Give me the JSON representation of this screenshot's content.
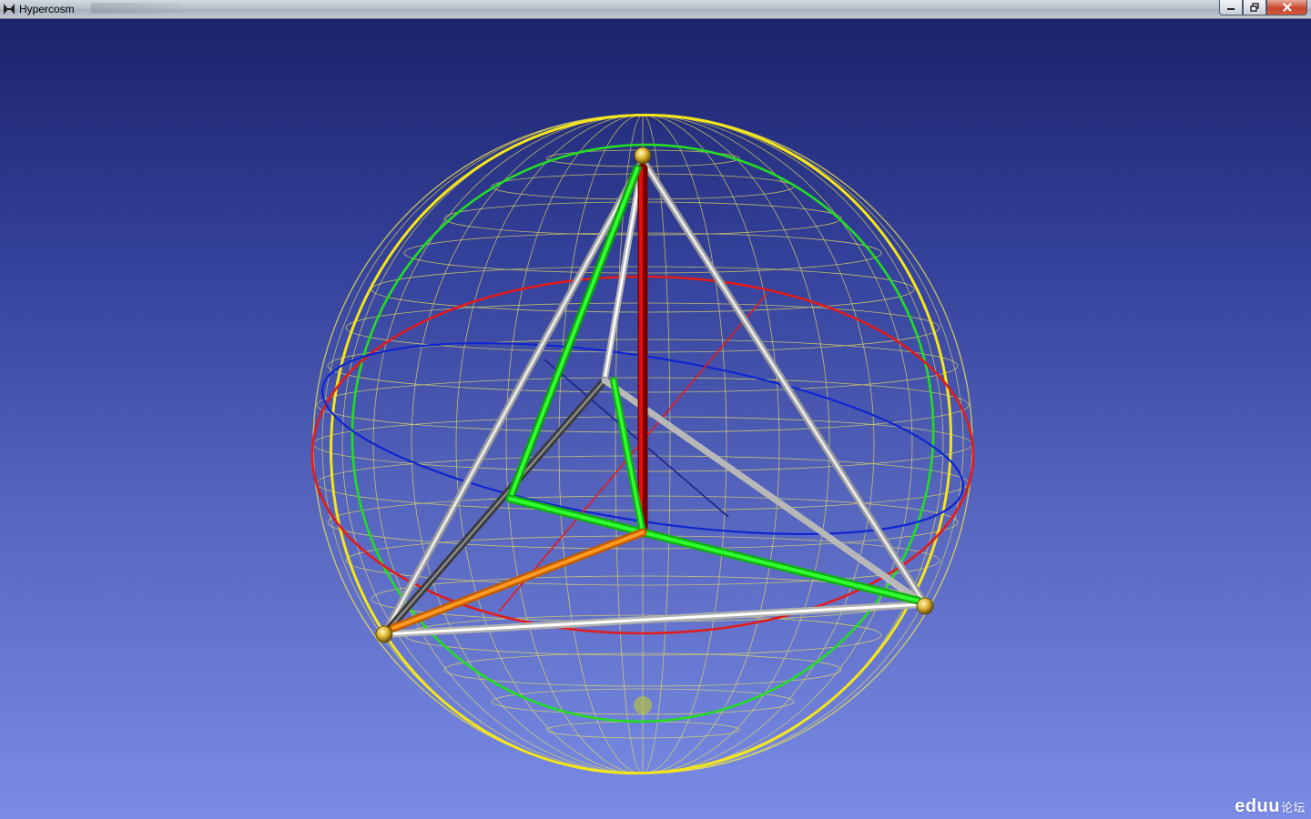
{
  "window": {
    "title": "Hypercosm",
    "controls": {
      "minimize": "minimize-icon",
      "maximize": "restore-icon",
      "close": "close-icon"
    }
  },
  "colors": {
    "background_top": "#1c236b",
    "background_bottom": "#7a8ce6",
    "sphere_wire": "#e8e05a",
    "equator_yellow": "#f0e020",
    "great_circle_green": "#1fe01f",
    "great_circle_red": "#e01a1a",
    "great_circle_blue": "#1020c8",
    "edge_silver": "#d8d8d8",
    "axis_red": "#c80000",
    "axis_green": "#20f020",
    "axis_orange": "#ff8c10"
  },
  "scene": {
    "objects": [
      "wireframe-sphere",
      "tetrahedron-edges",
      "center-axes",
      "vertex-spheres"
    ]
  },
  "watermark": {
    "brand": "eduu",
    "suffix": "论坛"
  }
}
